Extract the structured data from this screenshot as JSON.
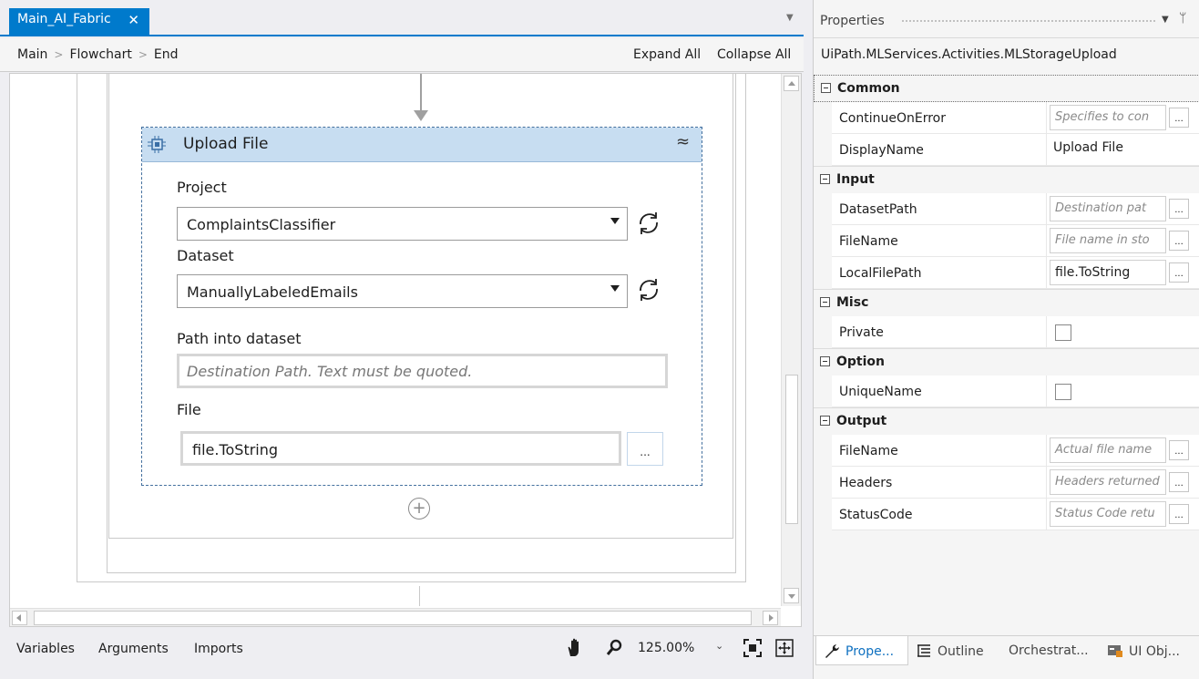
{
  "document_tab": {
    "title": "Main_AI_Fabric",
    "close": "✕"
  },
  "breadcrumb": {
    "items": [
      "Main",
      "Flowchart",
      "End"
    ],
    "separator": ">"
  },
  "header_actions": {
    "expand_all": "Expand All",
    "collapse_all": "Collapse All"
  },
  "activity": {
    "title": "Upload File",
    "project_label": "Project",
    "project_value": "ComplaintsClassifier",
    "dataset_label": "Dataset",
    "dataset_value": "ManuallyLabeledEmails",
    "path_label": "Path into dataset",
    "path_placeholder": "Destination Path. Text must be quoted.",
    "file_label": "File",
    "file_value": "file.ToString",
    "browse": "..."
  },
  "status_bar": {
    "variables": "Variables",
    "arguments": "Arguments",
    "imports": "Imports",
    "zoom": "125.00%",
    "zoom_drop": "⌄"
  },
  "properties": {
    "title": "Properties",
    "activity_type": "UiPath.MLServices.Activities.MLStorageUpload",
    "categories": {
      "common": "Common",
      "input": "Input",
      "misc": "Misc",
      "option": "Option",
      "output": "Output"
    },
    "rows": {
      "continue_on_error": {
        "name": "ContinueOnError",
        "placeholder": "Specifies to con"
      },
      "display_name": {
        "name": "DisplayName",
        "value": "Upload File"
      },
      "dataset_path": {
        "name": "DatasetPath",
        "placeholder": "Destination pat"
      },
      "file_name_in": {
        "name": "FileName",
        "placeholder": "File name in sto"
      },
      "local_file_path": {
        "name": "LocalFilePath",
        "value": "file.ToString"
      },
      "private": {
        "name": "Private",
        "checked": false
      },
      "unique_name": {
        "name": "UniqueName",
        "checked": false
      },
      "file_name_out": {
        "name": "FileName",
        "placeholder": "Actual file name"
      },
      "headers": {
        "name": "Headers",
        "placeholder": "Headers returned"
      },
      "status_code": {
        "name": "StatusCode",
        "placeholder": "Status Code retu"
      }
    },
    "more_button": "...",
    "bottom_tabs": [
      "Prope...",
      "Outline",
      "Orchestrat...",
      "UI Obj..."
    ]
  },
  "colors": {
    "accent": "#007acc",
    "activity_header": "#c7ddf1",
    "link": "#0e70c0"
  }
}
